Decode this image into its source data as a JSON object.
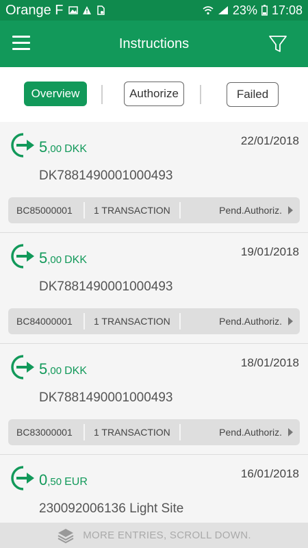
{
  "status": {
    "carrier": "Orange F",
    "battery": "23%",
    "time": "17:08",
    "icons": [
      "image-icon",
      "warning-icon",
      "sim-icon",
      "wifi-icon",
      "signal-icon",
      "battery-icon"
    ]
  },
  "header": {
    "title": "Instructions",
    "menu_icon": "hamburger-menu-icon",
    "filter_icon": "filter-funnel-icon"
  },
  "tabs": [
    {
      "label": "Overview",
      "active": true
    },
    {
      "label": "Authorize",
      "active": false
    },
    {
      "label": "Failed",
      "active": false
    }
  ],
  "instructions": [
    {
      "amount_int": "5",
      "amount_dec": ",00",
      "currency": "DKK",
      "date": "22/01/2018",
      "account": "DK7881490001000493",
      "reference": "BC85000001",
      "transactions": "1 TRANSACTION",
      "status": "Pend.Authoriz."
    },
    {
      "amount_int": "5",
      "amount_dec": ",00",
      "currency": "DKK",
      "date": "19/01/2018",
      "account": "DK7881490001000493",
      "reference": "BC84000001",
      "transactions": "1 TRANSACTION",
      "status": "Pend.Authoriz."
    },
    {
      "amount_int": "5",
      "amount_dec": ",00",
      "currency": "DKK",
      "date": "18/01/2018",
      "account": "DK7881490001000493",
      "reference": "BC83000001",
      "transactions": "1 TRANSACTION",
      "status": "Pend.Authoriz."
    },
    {
      "amount_int": "0",
      "amount_dec": ",50",
      "currency": "EUR",
      "date": "16/01/2018",
      "account": "230092006136 Light Site",
      "reference": "",
      "transactions": "",
      "status": ""
    }
  ],
  "footer": {
    "label": "MORE ENTRIES, SCROLL DOWN.",
    "icon": "layers-icon"
  },
  "colors": {
    "primary": "#12995a",
    "status_bar": "#0f8a4d"
  }
}
